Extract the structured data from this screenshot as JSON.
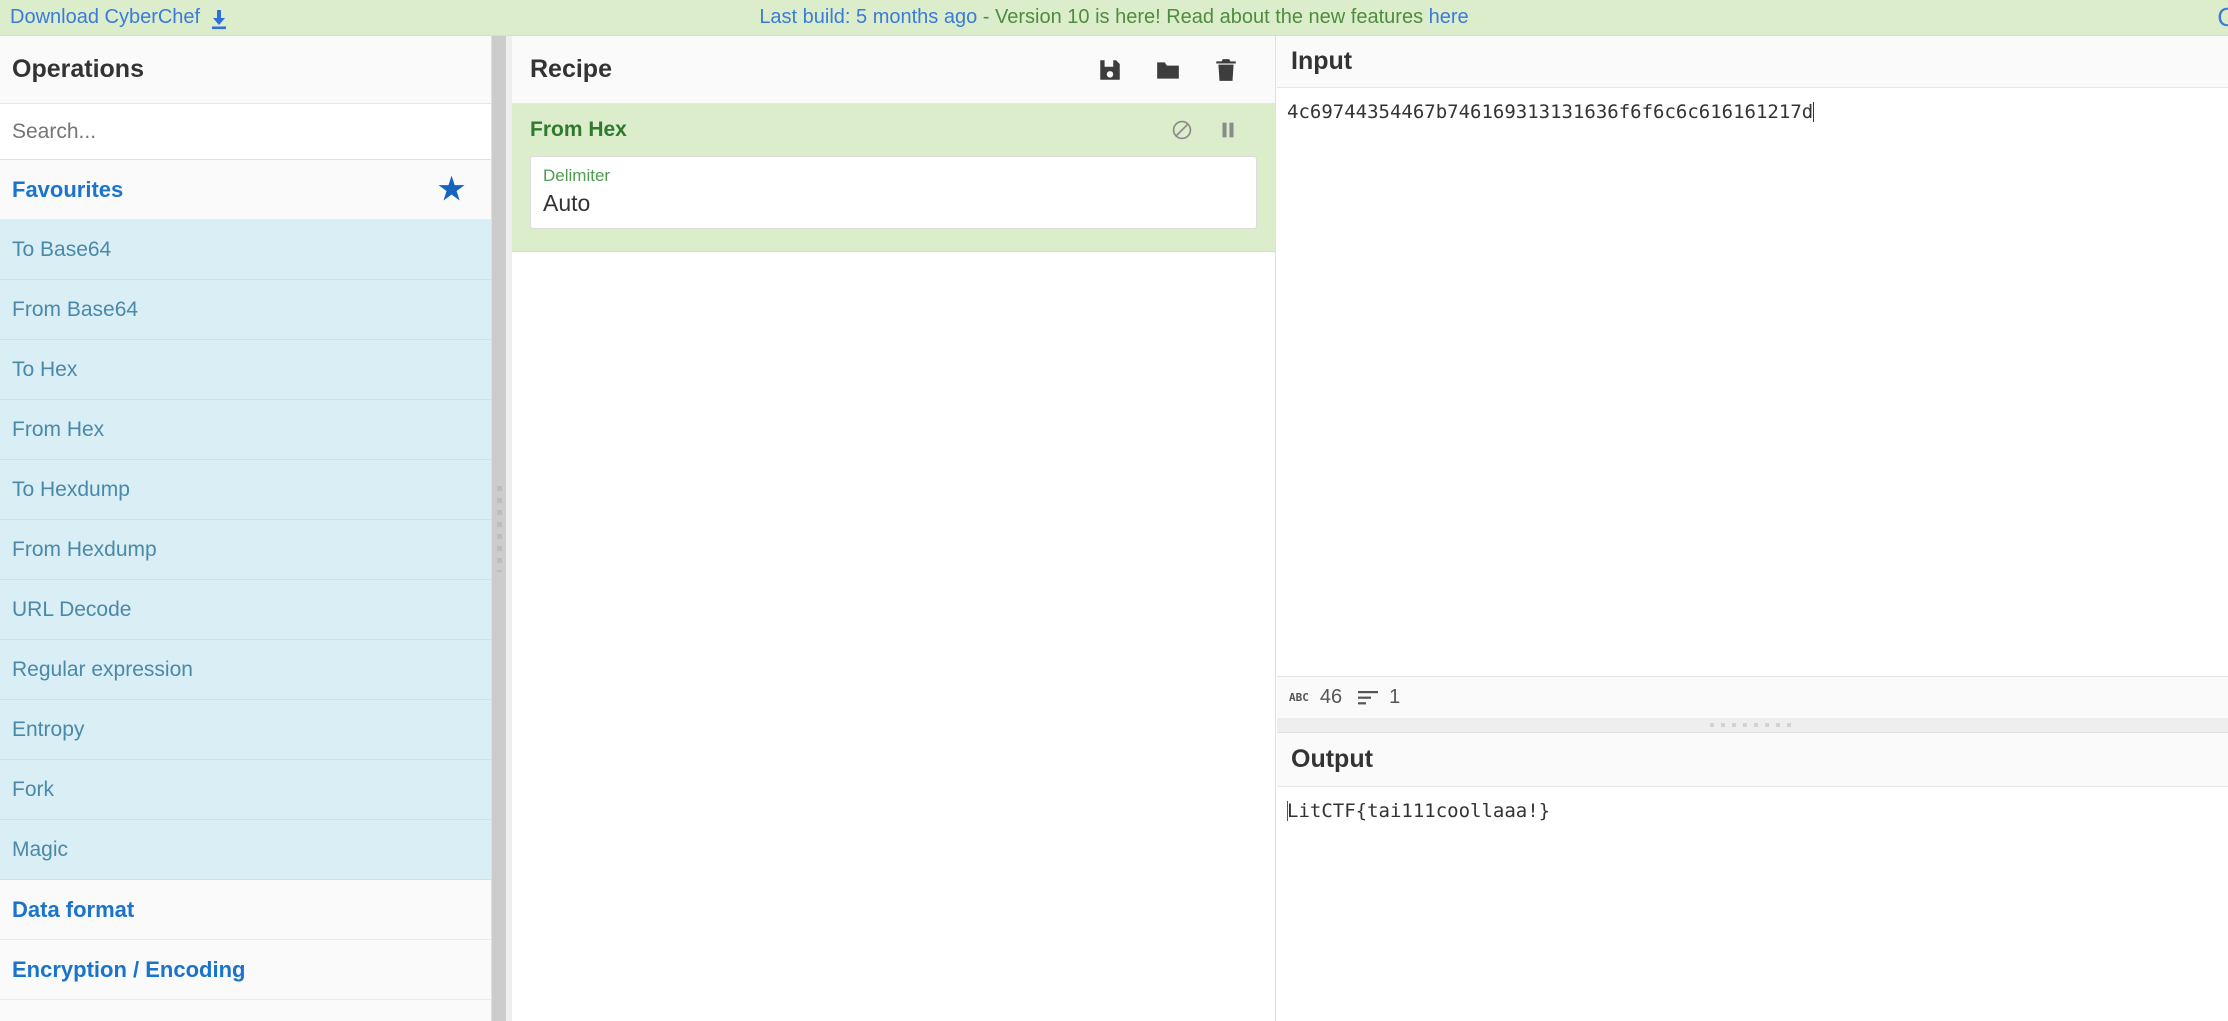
{
  "banner": {
    "download_label": "Download CyberChef",
    "download_icon": "download-arrow-icon",
    "build_text": "Last build: 5 months ago",
    "separator": " - ",
    "version_text": "Version 10 is here! Read about the new features ",
    "here_link": "here",
    "close_label": "C"
  },
  "operations": {
    "title": "Operations",
    "search_placeholder": "Search...",
    "search_value": "",
    "favourites_label": "Favourites",
    "star_icon": "star-icon",
    "favourites": [
      "To Base64",
      "From Base64",
      "To Hex",
      "From Hex",
      "To Hexdump",
      "From Hexdump",
      "URL Decode",
      "Regular expression",
      "Entropy",
      "Fork",
      "Magic"
    ],
    "categories": [
      "Data format",
      "Encryption / Encoding"
    ]
  },
  "recipe": {
    "title": "Recipe",
    "icons": {
      "save": "save-floppy-icon",
      "load": "folder-open-icon",
      "clear": "trash-icon"
    },
    "operations": [
      {
        "name": "From Hex",
        "disable_icon": "disable-circle-slash-icon",
        "breakpoint_icon": "pause-breakpoint-icon",
        "args": [
          {
            "label": "Delimiter",
            "value": "Auto"
          }
        ]
      }
    ]
  },
  "input": {
    "title": "Input",
    "value": "4c69744354467b746169313131636f6f6c6c616161217d",
    "status": {
      "chars_icon": "abc-character-count-icon",
      "chars": "46",
      "lines_icon": "line-count-icon",
      "lines": "1"
    }
  },
  "output": {
    "title": "Output",
    "value": "LitCTF{tai111coollaaa!}"
  },
  "colors": {
    "banner_bg": "#dcedcc",
    "link_blue": "#3a7bdb",
    "green_text": "#4e8c3f",
    "op_item_bg": "#d9eef5",
    "op_item_text": "#4a89a8",
    "category_blue": "#1a73cc",
    "recipe_op_bg": "#dcedcc",
    "recipe_op_title": "#2f7a2f"
  }
}
